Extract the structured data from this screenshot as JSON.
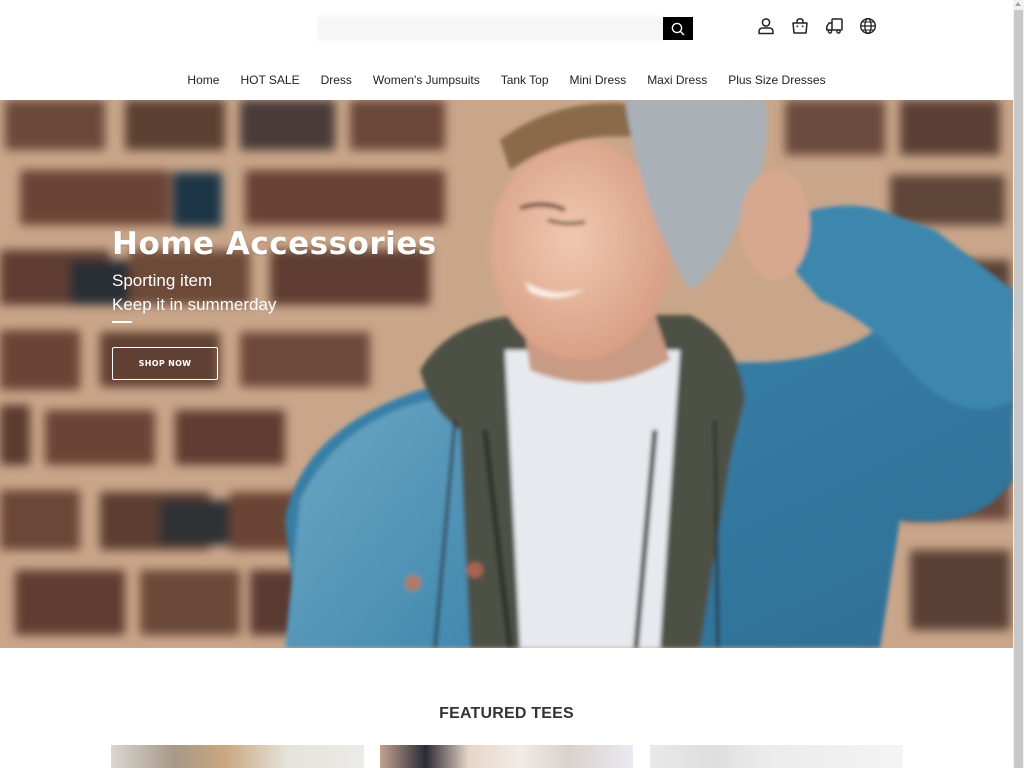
{
  "header": {
    "search": {
      "placeholder": "",
      "value": "",
      "button_icon": "search-icon"
    },
    "icons": [
      {
        "name": "account-icon",
        "label": "Account"
      },
      {
        "name": "cart-icon",
        "label": "Cart"
      },
      {
        "name": "shipping-truck-icon",
        "label": "Track order"
      },
      {
        "name": "globe-icon",
        "label": "Language"
      }
    ]
  },
  "nav": {
    "items": [
      {
        "label": "Home"
      },
      {
        "label": "HOT SALE"
      },
      {
        "label": "Dress"
      },
      {
        "label": "Women's Jumpsuits"
      },
      {
        "label": "Tank Top"
      },
      {
        "label": "Mini Dress"
      },
      {
        "label": "Maxi Dress"
      },
      {
        "label": "Plus Size Dresses"
      }
    ]
  },
  "hero": {
    "title": "Home Accessories",
    "subtitle_1": "Sporting item",
    "subtitle_2": "Keep it in summerday",
    "button_label": "SHOP NOW",
    "image_alt": "Smiling man in grey beanie and denim jacket against brick wall"
  },
  "featured": {
    "title": "FEATURED TEES",
    "products": [
      {
        "image_alt": "Woman with wavy blonde hair in black top"
      },
      {
        "image_alt": "Woman with platinum hair in black top"
      },
      {
        "image_alt": "Woman in black top on white background"
      }
    ]
  },
  "colors": {
    "accent": "#000000",
    "text": "#222222",
    "hero_text": "#ffffff"
  }
}
